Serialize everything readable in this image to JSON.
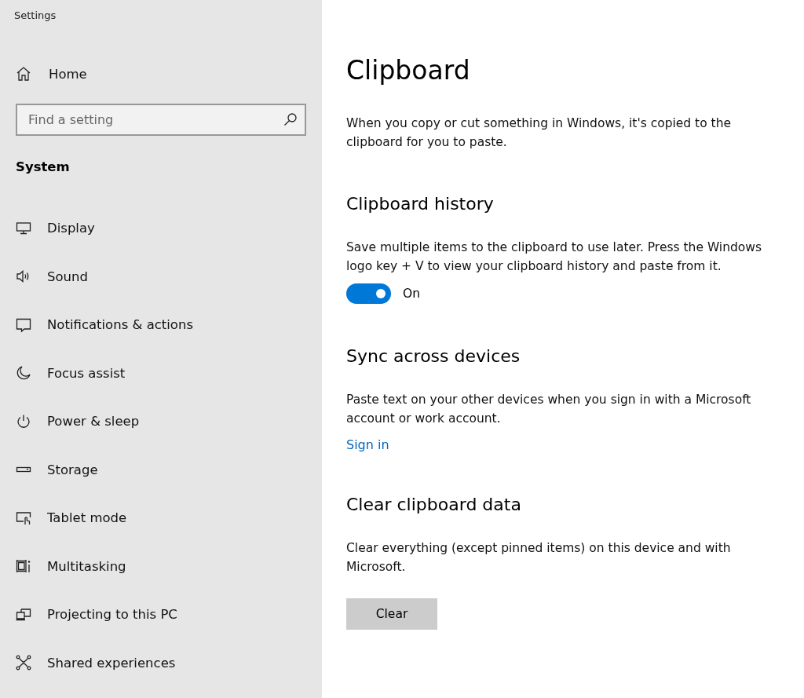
{
  "window": {
    "title": "Settings"
  },
  "sidebar": {
    "home": {
      "label": "Home"
    },
    "search": {
      "placeholder": "Find a setting"
    },
    "group": "System",
    "items": [
      {
        "label": "Display"
      },
      {
        "label": "Sound"
      },
      {
        "label": "Notifications & actions"
      },
      {
        "label": "Focus assist"
      },
      {
        "label": "Power & sleep"
      },
      {
        "label": "Storage"
      },
      {
        "label": "Tablet mode"
      },
      {
        "label": "Multitasking"
      },
      {
        "label": "Projecting to this PC"
      },
      {
        "label": "Shared experiences"
      }
    ]
  },
  "page": {
    "title": "Clipboard",
    "intro": "When you copy or cut something in Windows, it's copied to the clipboard for you to paste.",
    "sections": [
      {
        "kind": "toggle",
        "heading": "Clipboard history",
        "text": "Save multiple items to the clipboard to use later. Press the Windows logo key + V to view your clipboard history and paste from it.",
        "on": true,
        "state_label": "On"
      },
      {
        "kind": "link",
        "heading": "Sync across devices",
        "text": "Paste text on your other devices when you sign in with a Microsoft account or work account.",
        "link": "Sign in"
      },
      {
        "kind": "button",
        "heading": "Clear clipboard data",
        "text": "Clear everything (except pinned items) on this device and with Microsoft.",
        "button": "Clear"
      }
    ]
  }
}
